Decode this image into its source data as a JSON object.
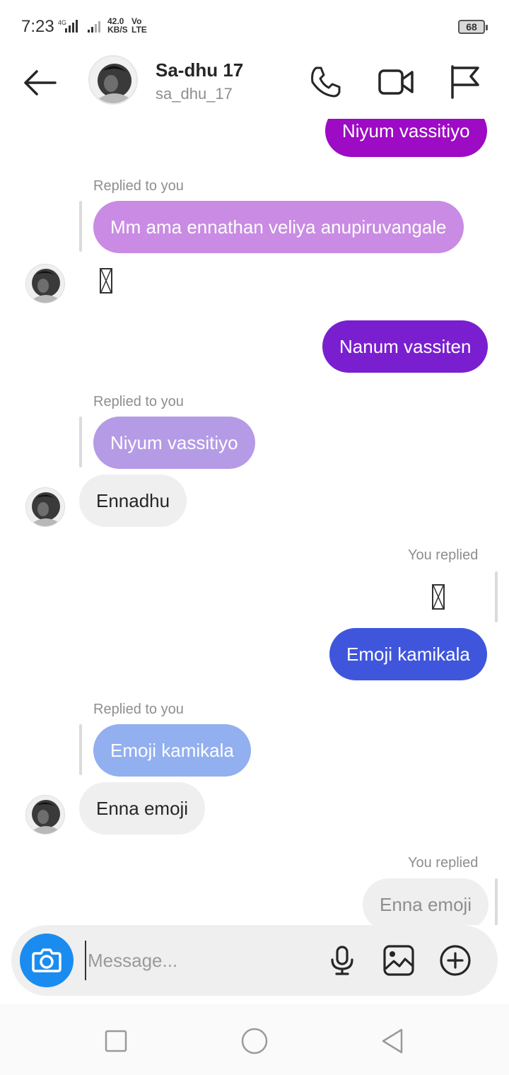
{
  "status_bar": {
    "time": "7:23",
    "speed": "42.0",
    "speed_unit": "KB/S",
    "volte_top": "Vo",
    "volte_bottom": "LTE",
    "battery": "68"
  },
  "header": {
    "name": "Sa-dhu 17",
    "username": "sa_dhu_17"
  },
  "messages": {
    "m1": {
      "text": "Niyum vassitiyo",
      "color": "#9d0bc4"
    },
    "m2": {
      "reply_label": "Replied to you",
      "quoted": "Mm ama ennathan veliya anupiruvangale",
      "quoted_color": "#c98be3"
    },
    "m4": {
      "text": "Nanum vassiten",
      "color": "#7a1fcf"
    },
    "m5": {
      "reply_label": "Replied to you",
      "quoted": "Niyum vassitiyo",
      "quoted_color": "#b59be6",
      "text": "Ennadhu"
    },
    "m6": {
      "reply_label": "You replied",
      "text": "Emoji kamikala",
      "color": "#3f56dc"
    },
    "m7": {
      "reply_label": "Replied to you",
      "quoted": "Emoji kamikala",
      "quoted_color": "#92aff0",
      "text": "Enna emoji"
    },
    "m8": {
      "reply_label": "You replied",
      "quoted": "Enna emoji"
    }
  },
  "composer": {
    "placeholder": "Message...",
    "value": ""
  },
  "icons": {
    "back": "arrow-left-icon",
    "call": "phone-icon",
    "video": "video-camera-icon",
    "report": "flag-icon",
    "camera": "camera-icon",
    "mic": "microphone-icon",
    "gallery": "image-icon",
    "add": "plus-circle-icon"
  }
}
